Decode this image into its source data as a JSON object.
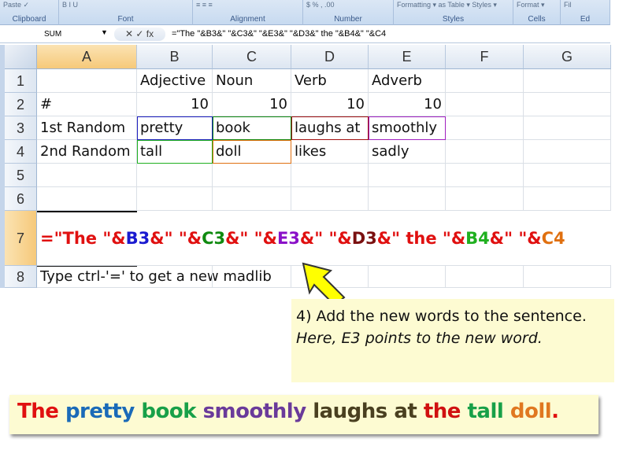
{
  "ribbon": {
    "groups": [
      {
        "label": "Clipboard",
        "top": "Paste ✓"
      },
      {
        "label": "Font",
        "top": "B  I  U"
      },
      {
        "label": "Alignment",
        "top": "≡ ≡ ≡"
      },
      {
        "label": "Number",
        "top": "$  %  ,  .00"
      },
      {
        "label": "Styles",
        "top": "Formatting ▾ as Table ▾ Styles ▾"
      },
      {
        "label": "Cells",
        "top": "Format ▾"
      },
      {
        "label": "Ed",
        "top": "Fil"
      }
    ]
  },
  "formula_bar": {
    "name_box": "SUM",
    "buttons": "✕  ✓  fx",
    "formula": "=\"The \"&B3&\" \"&C3&\" \"&E3&\" \"&D3&\" the \"&B4&\" \"&C4"
  },
  "columns": [
    "A",
    "B",
    "C",
    "D",
    "E",
    "F",
    "G"
  ],
  "rows": [
    "1",
    "2",
    "3",
    "4",
    "5",
    "6",
    "7",
    "8"
  ],
  "cells": {
    "B1": "Adjective",
    "C1": "Noun",
    "D1": "Verb",
    "E1": "Adverb",
    "A2": "#",
    "B2": "10",
    "C2": "10",
    "D2": "10",
    "E2": "10",
    "A3": "1st Random",
    "B3": "pretty",
    "C3": "book",
    "D3": "laughs at",
    "E3": "smoothly",
    "A4": "2nd Random",
    "B4": "tall",
    "C4": "doll",
    "D4": "likes",
    "E4": "sadly",
    "A8": "Type ctrl-'=' to get a new madlib"
  },
  "formula_cell": [
    {
      "t": "=\"The \"&",
      "c": "#e01010"
    },
    {
      "t": "B3",
      "c": "#1a1ad0"
    },
    {
      "t": "&\" \"&",
      "c": "#e01010"
    },
    {
      "t": "C3",
      "c": "#108a10"
    },
    {
      "t": "&\" \"&",
      "c": "#e01010"
    },
    {
      "t": "E3",
      "c": "#8a10c8"
    },
    {
      "t": "&\" \"&",
      "c": "#e01010"
    },
    {
      "t": "D3",
      "c": "#7a1010"
    },
    {
      "t": "&\" the \"&",
      "c": "#e01010"
    },
    {
      "t": "B4",
      "c": "#20b020"
    },
    {
      "t": "&\" \"&",
      "c": "#e01010"
    },
    {
      "t": "C4",
      "c": "#e07010"
    }
  ],
  "callout": {
    "line1": "4) Add the new words to the sentence.",
    "line2": "Here, E3 points to the new word."
  },
  "result_sentence": [
    {
      "t": "The ",
      "c": "#e01010"
    },
    {
      "t": "pretty ",
      "c": "#1a6ab8"
    },
    {
      "t": "book ",
      "c": "#18a048"
    },
    {
      "t": "smoothly ",
      "c": "#6a3a9a"
    },
    {
      "t": "laughs at ",
      "c": "#4a4020"
    },
    {
      "t": "the ",
      "c": "#d01010"
    },
    {
      "t": "tall ",
      "c": "#18a048"
    },
    {
      "t": "doll",
      "c": "#e07820"
    },
    {
      "t": ".",
      "c": "#e01010"
    }
  ],
  "colors": {
    "arrow": "#ffff00",
    "callout_bg": "#fdfbd2",
    "selected_header": "#f6c97a"
  }
}
